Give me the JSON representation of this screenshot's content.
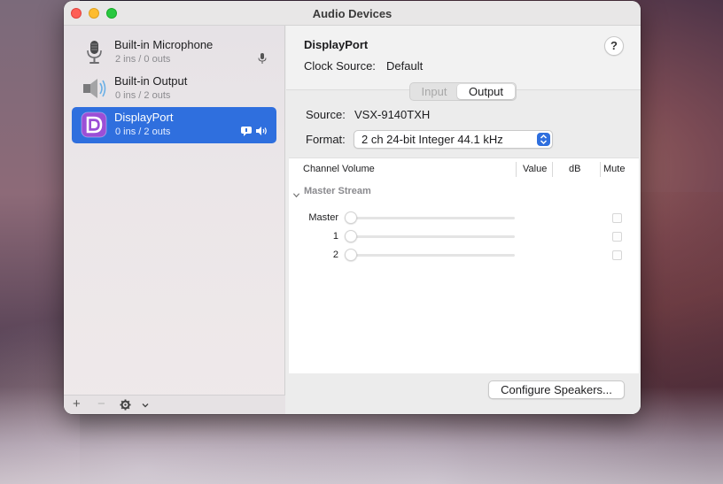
{
  "window": {
    "title": "Audio Devices"
  },
  "devices": [
    {
      "name": "Built-in Microphone",
      "sub": "2 ins / 0 outs",
      "icon": "microphone-icon",
      "selected": false
    },
    {
      "name": "Built-in Output",
      "sub": "0 ins / 2 outs",
      "icon": "speaker-icon",
      "selected": false
    },
    {
      "name": "DisplayPort",
      "sub": "0 ins / 2 outs",
      "icon": "displayport-icon",
      "selected": true
    }
  ],
  "sidebar_toolbar": {
    "add": "+",
    "remove": "−"
  },
  "detail": {
    "device_name": "DisplayPort",
    "clock_label": "Clock Source:",
    "clock_value": "Default",
    "help": "?",
    "tabs": {
      "input": "Input",
      "output": "Output",
      "selected": "Output"
    },
    "source_label": "Source:",
    "source_value": "VSX-9140TXH",
    "format_label": "Format:",
    "format_value": "2 ch 24-bit Integer 44.1 kHz",
    "table": {
      "headers": {
        "channel_volume": "Channel Volume",
        "value": "Value",
        "db": "dB",
        "mute": "Mute"
      },
      "group": "Master Stream",
      "channels": [
        {
          "label": "Master",
          "volume": 0,
          "muted": false
        },
        {
          "label": "1",
          "volume": 0,
          "muted": false
        },
        {
          "label": "2",
          "volume": 0,
          "muted": false
        }
      ]
    },
    "configure_button": "Configure Speakers..."
  },
  "colors": {
    "accent": "#2f6fde",
    "close": "#fe5f57",
    "minimize": "#febc2e",
    "zoom": "#28c840"
  }
}
